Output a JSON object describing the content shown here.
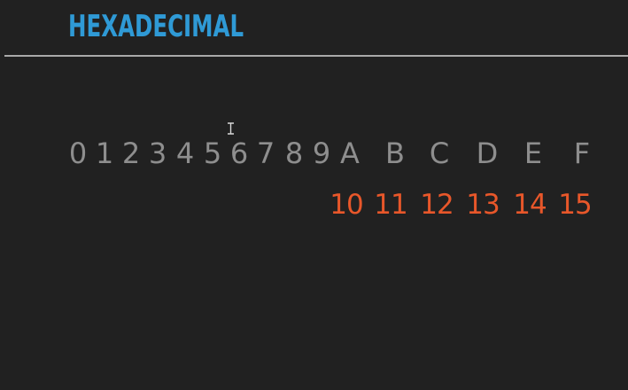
{
  "slide": {
    "title": "HEXADECIMAL",
    "digits": [
      "0",
      "1",
      "2",
      "3",
      "4",
      "5",
      "6",
      "7",
      "8",
      "9",
      "A",
      "B",
      "C",
      "D",
      "E",
      "F"
    ],
    "letter_values": [
      "10",
      "11",
      "12",
      "13",
      "14",
      "15"
    ],
    "colors": {
      "background": "#212121",
      "title": "#2f9ad6",
      "rule": "#a9a9a9",
      "digits": "#8e8e8e",
      "values": "#e8572a"
    },
    "cursor_icon": "text-cursor-icon"
  }
}
